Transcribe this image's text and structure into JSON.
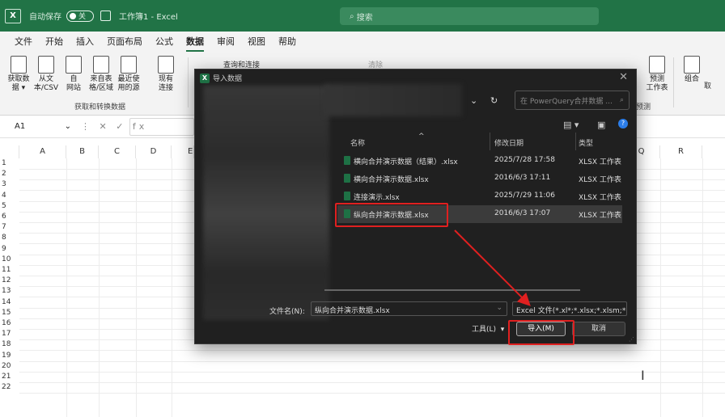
{
  "titlebar": {
    "autosave_label": "自动保存",
    "autosave_state": "关",
    "workbook_title": "工作簿1 - Excel",
    "search_placeholder": "搜索"
  },
  "menu": {
    "tabs": [
      "文件",
      "开始",
      "插入",
      "页面布局",
      "公式",
      "数据",
      "审阅",
      "视图",
      "帮助"
    ],
    "active_tab": "数据"
  },
  "ribbon": {
    "get_data": "获取数\n据 ▾",
    "from_text_csv": "从文\n本/CSV",
    "from_web": "自\n网站",
    "from_table": "来自表\n格/区域",
    "recent_sources": "最近使\n用的源",
    "existing_connections": "现有\n连接",
    "group_label": "获取和转换数据",
    "queries_connections": "查询和连接",
    "clear": "清除",
    "forecast_sheet": "预测\n工作表",
    "forecast_group": "预测",
    "group": "组合",
    "overflow": "取"
  },
  "formulabar": {
    "name_box": "A1",
    "controls": "⋮ ✕ ✓ fx"
  },
  "grid": {
    "columns": [
      "A",
      "B",
      "C",
      "D",
      "E",
      "Q",
      "R"
    ],
    "rows": [
      "1",
      "2",
      "3",
      "4",
      "5",
      "6",
      "7",
      "8",
      "9",
      "10",
      "11",
      "12",
      "13",
      "14",
      "15",
      "16",
      "17",
      "18",
      "19",
      "20",
      "21",
      "22"
    ]
  },
  "dialog": {
    "title": "导入数据",
    "search_placeholder": "在 PowerQuery合并数据 ...",
    "columns": {
      "name": "名称",
      "date": "修改日期",
      "type": "类型"
    },
    "files": [
      {
        "name": "横向合并演示数据（结果）.xlsx",
        "date": "2025/7/28 17:58",
        "type": "XLSX 工作表"
      },
      {
        "name": "横向合并演示数据.xlsx",
        "date": "2016/6/3 17:11",
        "type": "XLSX 工作表"
      },
      {
        "name": "连接演示.xlsx",
        "date": "2025/7/29 11:06",
        "type": "XLSX 工作表"
      },
      {
        "name": "纵向合并演示数据.xlsx",
        "date": "2016/6/3 17:07",
        "type": "XLSX 工作表"
      }
    ],
    "selected_index": 3,
    "filename_label": "文件名(N):",
    "filename_value": "纵向合并演示数据.xlsx",
    "file_type": "Excel 文件(*.xl*;*.xlsx;*.xlsm;*",
    "tools_label": "工具(L)",
    "open_button": "导入(M)",
    "cancel_button": "取消"
  },
  "colors": {
    "accent": "#217346",
    "annotation": "#e02020"
  }
}
